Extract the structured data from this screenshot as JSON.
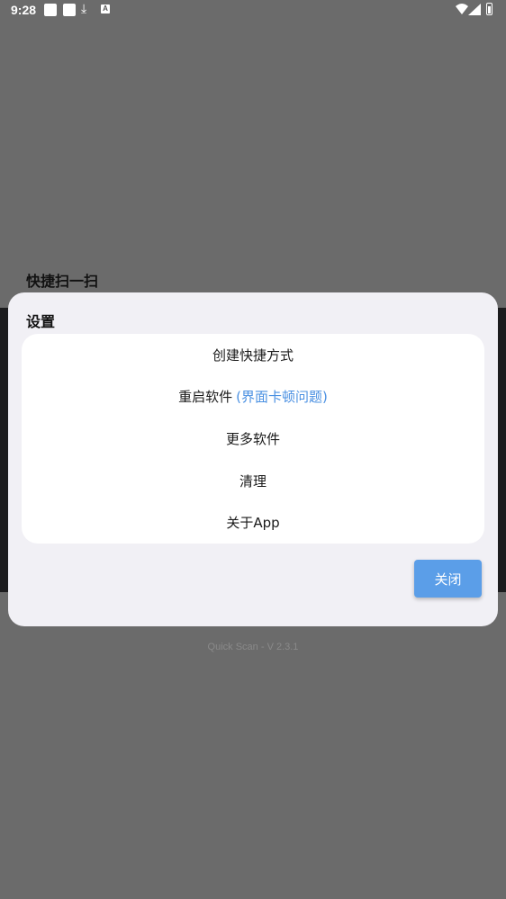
{
  "status_bar": {
    "time": "9:28",
    "notification_icons": [
      "square-icon",
      "square-icon",
      "download-icon",
      "a-icon"
    ],
    "a_icon_text": "A",
    "right_icons": [
      "wifi-icon",
      "signal-icon",
      "battery-icon"
    ]
  },
  "background": {
    "title": "快捷扫一扫",
    "footer": "Quick Scan - V 2.3.1"
  },
  "dialog": {
    "title": "设置",
    "items": [
      {
        "label": "创建快捷方式",
        "hint": ""
      },
      {
        "label": "重启软件",
        "hint": "(界面卡顿问题)"
      },
      {
        "label": "更多软件",
        "hint": ""
      },
      {
        "label": "清理",
        "hint": ""
      },
      {
        "label": "关于App",
        "hint": ""
      }
    ],
    "close_label": "关闭"
  },
  "colors": {
    "scrim": "#6b6b6b",
    "dialog_bg": "#f1f0f5",
    "accent": "#5b9ee8",
    "hint_text": "#4a90e2"
  }
}
